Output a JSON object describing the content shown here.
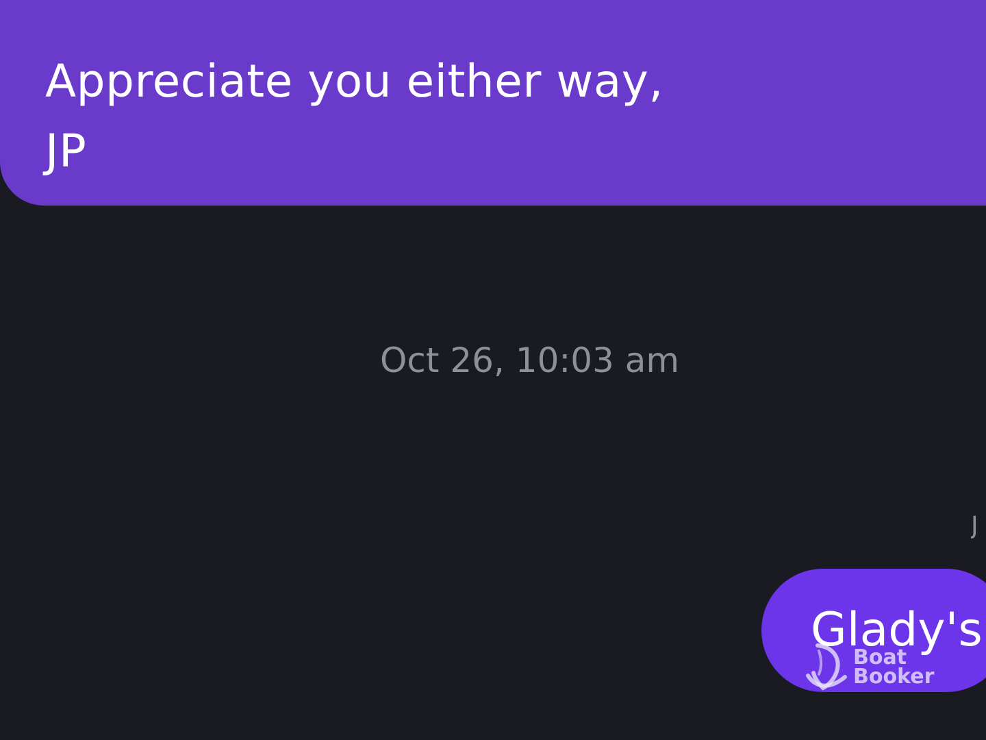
{
  "messages": [
    {
      "text": "Appreciate you either way,\nJP",
      "direction": "outgoing"
    },
    {
      "text": "Glady's",
      "direction": "outgoing"
    }
  ],
  "timestamp": "Oct 26, 10:03 am",
  "clipped_label": "J",
  "watermark": {
    "text": "Boat\nBooker",
    "icon": "boat-icon"
  },
  "colors": {
    "background": "#1a1a22",
    "bubble_primary": "#6a3bcb",
    "bubble_secondary": "#6d35ea",
    "timestamp": "#8f8f98",
    "text": "#ffffff"
  }
}
